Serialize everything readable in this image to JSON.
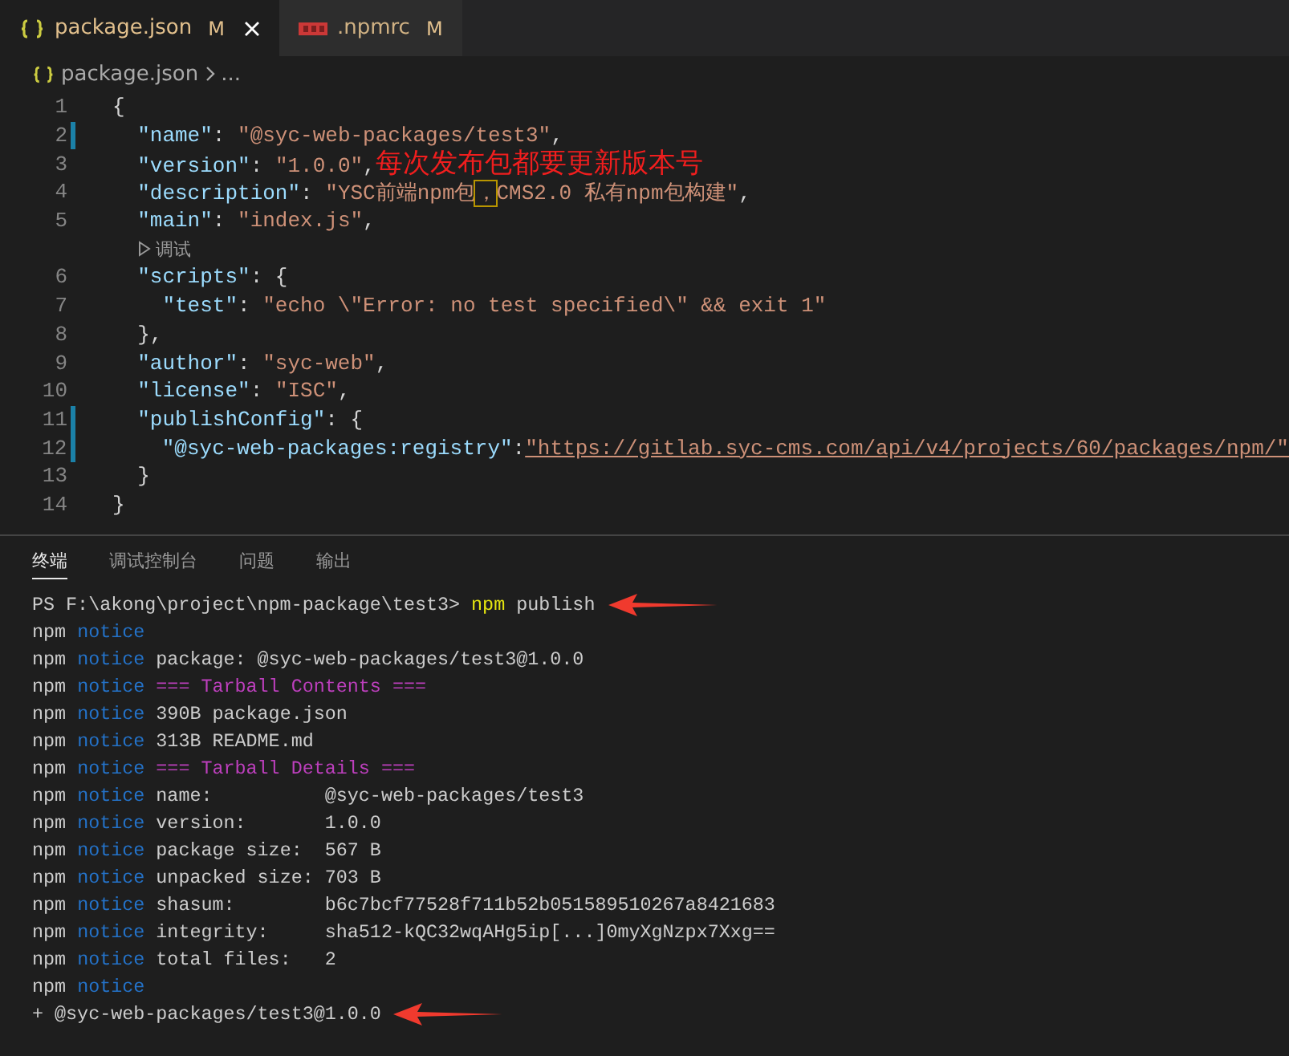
{
  "tabs": [
    {
      "label": "package.json",
      "modified": "M",
      "selected": true
    },
    {
      "label": ".npmrc",
      "modified": "M",
      "selected": false
    }
  ],
  "breadcrumb": [
    "package.json",
    "..."
  ],
  "code_lines": [
    {
      "kind": "code",
      "number": "1",
      "changed": false,
      "tokens": [
        {
          "kind": "punct",
          "text": "{"
        }
      ]
    },
    {
      "kind": "code",
      "number": "2",
      "changed": true,
      "tokens": [
        {
          "kind": "key",
          "text": "  \"name\""
        },
        {
          "kind": "punct",
          "text": ": "
        },
        {
          "kind": "string",
          "text": "\"@syc-web-packages/test3\""
        },
        {
          "kind": "punct",
          "text": ","
        }
      ]
    },
    {
      "kind": "code",
      "number": "3",
      "changed": false,
      "tokens": [
        {
          "kind": "key",
          "text": "  \"version\""
        },
        {
          "kind": "punct",
          "text": ": "
        },
        {
          "kind": "string",
          "text": "\"1.0.0\""
        },
        {
          "kind": "punct",
          "text": ","
        },
        {
          "kind": "note",
          "text": "每次发布包都要更新版本号"
        }
      ]
    },
    {
      "kind": "code",
      "number": "4",
      "changed": false,
      "tokens": [
        {
          "kind": "key",
          "text": "  \"description\""
        },
        {
          "kind": "punct",
          "text": ": "
        },
        {
          "kind": "string",
          "text": "\"YSC前端npm包"
        },
        {
          "kind": "boxed",
          "text": "，"
        },
        {
          "kind": "string",
          "text": "CMS2.0 私有npm包构建\""
        },
        {
          "kind": "punct",
          "text": ","
        }
      ]
    },
    {
      "kind": "code",
      "number": "5",
      "changed": false,
      "tokens": [
        {
          "kind": "key",
          "text": "  \"main\""
        },
        {
          "kind": "punct",
          "text": ": "
        },
        {
          "kind": "string",
          "text": "\"index.js\""
        },
        {
          "kind": "punct",
          "text": ","
        }
      ]
    },
    {
      "kind": "codelens",
      "text": "调试"
    },
    {
      "kind": "code",
      "number": "6",
      "changed": false,
      "tokens": [
        {
          "kind": "key",
          "text": "  \"scripts\""
        },
        {
          "kind": "punct",
          "text": ": {"
        }
      ]
    },
    {
      "kind": "code",
      "number": "7",
      "changed": false,
      "tokens": [
        {
          "kind": "key",
          "text": "    \"test\""
        },
        {
          "kind": "punct",
          "text": ": "
        },
        {
          "kind": "string",
          "text": "\"echo \\\"Error: no test specified\\\" && exit 1\""
        }
      ]
    },
    {
      "kind": "code",
      "number": "8",
      "changed": false,
      "tokens": [
        {
          "kind": "punct",
          "text": "  },"
        }
      ]
    },
    {
      "kind": "code",
      "number": "9",
      "changed": false,
      "tokens": [
        {
          "kind": "key",
          "text": "  \"author\""
        },
        {
          "kind": "punct",
          "text": ": "
        },
        {
          "kind": "string",
          "text": "\"syc-web\""
        },
        {
          "kind": "punct",
          "text": ","
        }
      ]
    },
    {
      "kind": "code",
      "number": "10",
      "changed": false,
      "tokens": [
        {
          "kind": "key",
          "text": "  \"license\""
        },
        {
          "kind": "punct",
          "text": ": "
        },
        {
          "kind": "string",
          "text": "\"ISC\""
        },
        {
          "kind": "punct",
          "text": ","
        }
      ]
    },
    {
      "kind": "code",
      "number": "11",
      "changed": true,
      "tokens": [
        {
          "kind": "key",
          "text": "  \"publishConfig\""
        },
        {
          "kind": "punct",
          "text": ": {"
        }
      ]
    },
    {
      "kind": "code",
      "number": "12",
      "changed": true,
      "tokens": [
        {
          "kind": "key",
          "text": "    \"@syc-web-packages:registry\""
        },
        {
          "kind": "punct",
          "text": ":"
        },
        {
          "kind": "link",
          "text": "\"https://gitlab.syc-cms.com/api/v4/projects/60/packages/npm/\""
        }
      ]
    },
    {
      "kind": "code",
      "number": "13",
      "changed": false,
      "tokens": [
        {
          "kind": "punct",
          "text": "  }"
        }
      ]
    },
    {
      "kind": "code",
      "number": "14",
      "changed": false,
      "tokens": [
        {
          "kind": "punct",
          "text": "}"
        }
      ]
    }
  ],
  "panel_tabs": [
    {
      "label": "终端",
      "selected": true
    },
    {
      "label": "调试控制台",
      "selected": false
    },
    {
      "label": "问题",
      "selected": false
    },
    {
      "label": "输出",
      "selected": false
    }
  ],
  "terminal_lines": [
    {
      "arrow": true,
      "segments": [
        {
          "kind": "plain",
          "text": "PS F:\\akong\\project\\npm-package\\test3> "
        },
        {
          "kind": "command",
          "text": "npm"
        },
        {
          "kind": "plain",
          "text": " publish"
        }
      ]
    },
    {
      "arrow": false,
      "segments": [
        {
          "kind": "plain",
          "text": "npm "
        },
        {
          "kind": "notice",
          "text": "notice"
        }
      ]
    },
    {
      "arrow": false,
      "segments": [
        {
          "kind": "plain",
          "text": "npm "
        },
        {
          "kind": "notice",
          "text": "notice"
        },
        {
          "kind": "plain",
          "text": " package: @syc-web-packages/test3@1.0.0"
        }
      ]
    },
    {
      "arrow": false,
      "segments": [
        {
          "kind": "plain",
          "text": "npm "
        },
        {
          "kind": "notice",
          "text": "notice"
        },
        {
          "kind": "header",
          "text": " === Tarball Contents ==="
        }
      ]
    },
    {
      "arrow": false,
      "segments": [
        {
          "kind": "plain",
          "text": "npm "
        },
        {
          "kind": "notice",
          "text": "notice"
        },
        {
          "kind": "plain",
          "text": " 390B package.json"
        }
      ]
    },
    {
      "arrow": false,
      "segments": [
        {
          "kind": "plain",
          "text": "npm "
        },
        {
          "kind": "notice",
          "text": "notice"
        },
        {
          "kind": "plain",
          "text": " 313B README.md"
        }
      ]
    },
    {
      "arrow": false,
      "segments": [
        {
          "kind": "plain",
          "text": "npm "
        },
        {
          "kind": "notice",
          "text": "notice"
        },
        {
          "kind": "header",
          "text": " === Tarball Details ==="
        }
      ]
    },
    {
      "arrow": false,
      "segments": [
        {
          "kind": "plain",
          "text": "npm "
        },
        {
          "kind": "notice",
          "text": "notice"
        },
        {
          "kind": "plain",
          "text": " name:          @syc-web-packages/test3"
        }
      ]
    },
    {
      "arrow": false,
      "segments": [
        {
          "kind": "plain",
          "text": "npm "
        },
        {
          "kind": "notice",
          "text": "notice"
        },
        {
          "kind": "plain",
          "text": " version:       1.0.0"
        }
      ]
    },
    {
      "arrow": false,
      "segments": [
        {
          "kind": "plain",
          "text": "npm "
        },
        {
          "kind": "notice",
          "text": "notice"
        },
        {
          "kind": "plain",
          "text": " package size:  567 B"
        }
      ]
    },
    {
      "arrow": false,
      "segments": [
        {
          "kind": "plain",
          "text": "npm "
        },
        {
          "kind": "notice",
          "text": "notice"
        },
        {
          "kind": "plain",
          "text": " unpacked size: 703 B"
        }
      ]
    },
    {
      "arrow": false,
      "segments": [
        {
          "kind": "plain",
          "text": "npm "
        },
        {
          "kind": "notice",
          "text": "notice"
        },
        {
          "kind": "plain",
          "text": " shasum:        b6c7bcf77528f711b52b051589510267a8421683"
        }
      ]
    },
    {
      "arrow": false,
      "segments": [
        {
          "kind": "plain",
          "text": "npm "
        },
        {
          "kind": "notice",
          "text": "notice"
        },
        {
          "kind": "plain",
          "text": " integrity:     sha512-kQC32wqAHg5ip[...]0myXgNzpx7Xxg=="
        }
      ]
    },
    {
      "arrow": false,
      "segments": [
        {
          "kind": "plain",
          "text": "npm "
        },
        {
          "kind": "notice",
          "text": "notice"
        },
        {
          "kind": "plain",
          "text": " total files:   2"
        }
      ]
    },
    {
      "arrow": false,
      "segments": [
        {
          "kind": "plain",
          "text": "npm "
        },
        {
          "kind": "notice",
          "text": "notice"
        }
      ]
    },
    {
      "arrow": true,
      "segments": [
        {
          "kind": "plain",
          "text": "+ @syc-web-packages/test3@1.0.0"
        }
      ]
    }
  ]
}
